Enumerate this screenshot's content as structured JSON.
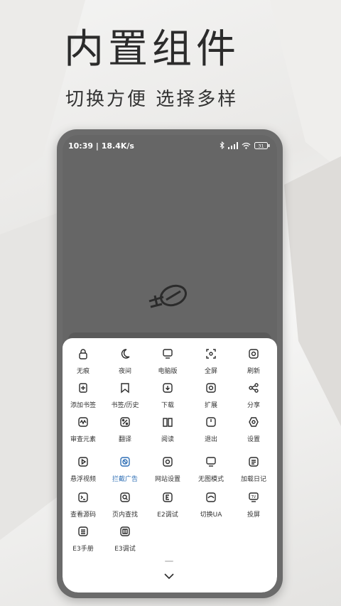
{
  "headline": "内置组件",
  "subline": "切换方便 选择多样",
  "status": {
    "time": "10:39 | 18.4K/s",
    "battery": "31"
  },
  "menu": [
    {
      "label": "无痕",
      "icon": "lock-icon"
    },
    {
      "label": "夜间",
      "icon": "moon-icon"
    },
    {
      "label": "电脑版",
      "icon": "monitor-icon"
    },
    {
      "label": "全屏",
      "icon": "fullscreen-icon"
    },
    {
      "label": "刷新",
      "icon": "refresh-icon"
    },
    {
      "label": "添加书签",
      "icon": "add-bookmark-icon"
    },
    {
      "label": "书签/历史",
      "icon": "bookmark-icon"
    },
    {
      "label": "下载",
      "icon": "download-icon"
    },
    {
      "label": "扩展",
      "icon": "extension-icon"
    },
    {
      "label": "分享",
      "icon": "share-icon"
    },
    {
      "label": "审查元素",
      "icon": "inspect-icon"
    },
    {
      "label": "翻译",
      "icon": "translate-icon"
    },
    {
      "label": "阅读",
      "icon": "book-icon"
    },
    {
      "label": "退出",
      "icon": "power-icon"
    },
    {
      "label": "设置",
      "icon": "settings-icon"
    },
    {
      "label": "悬浮视频",
      "icon": "play-icon"
    },
    {
      "label": "拦截广告",
      "icon": "block-ad-icon",
      "active": true
    },
    {
      "label": "网站设置",
      "icon": "site-settings-icon"
    },
    {
      "label": "无图模式",
      "icon": "no-image-icon"
    },
    {
      "label": "加载日记",
      "icon": "log-icon"
    },
    {
      "label": "查看源码",
      "icon": "source-icon"
    },
    {
      "label": "页内查找",
      "icon": "find-icon"
    },
    {
      "label": "E2调试",
      "icon": "e2-debug-icon"
    },
    {
      "label": "切换UA",
      "icon": "ua-icon"
    },
    {
      "label": "投屏",
      "icon": "cast-icon"
    },
    {
      "label": "E3手册",
      "icon": "e3-manual-icon"
    },
    {
      "label": "E3调试",
      "icon": "e3-debug-icon"
    }
  ],
  "colors": {
    "accent": "#2f6fb5",
    "icon": "#2b2b2b"
  }
}
